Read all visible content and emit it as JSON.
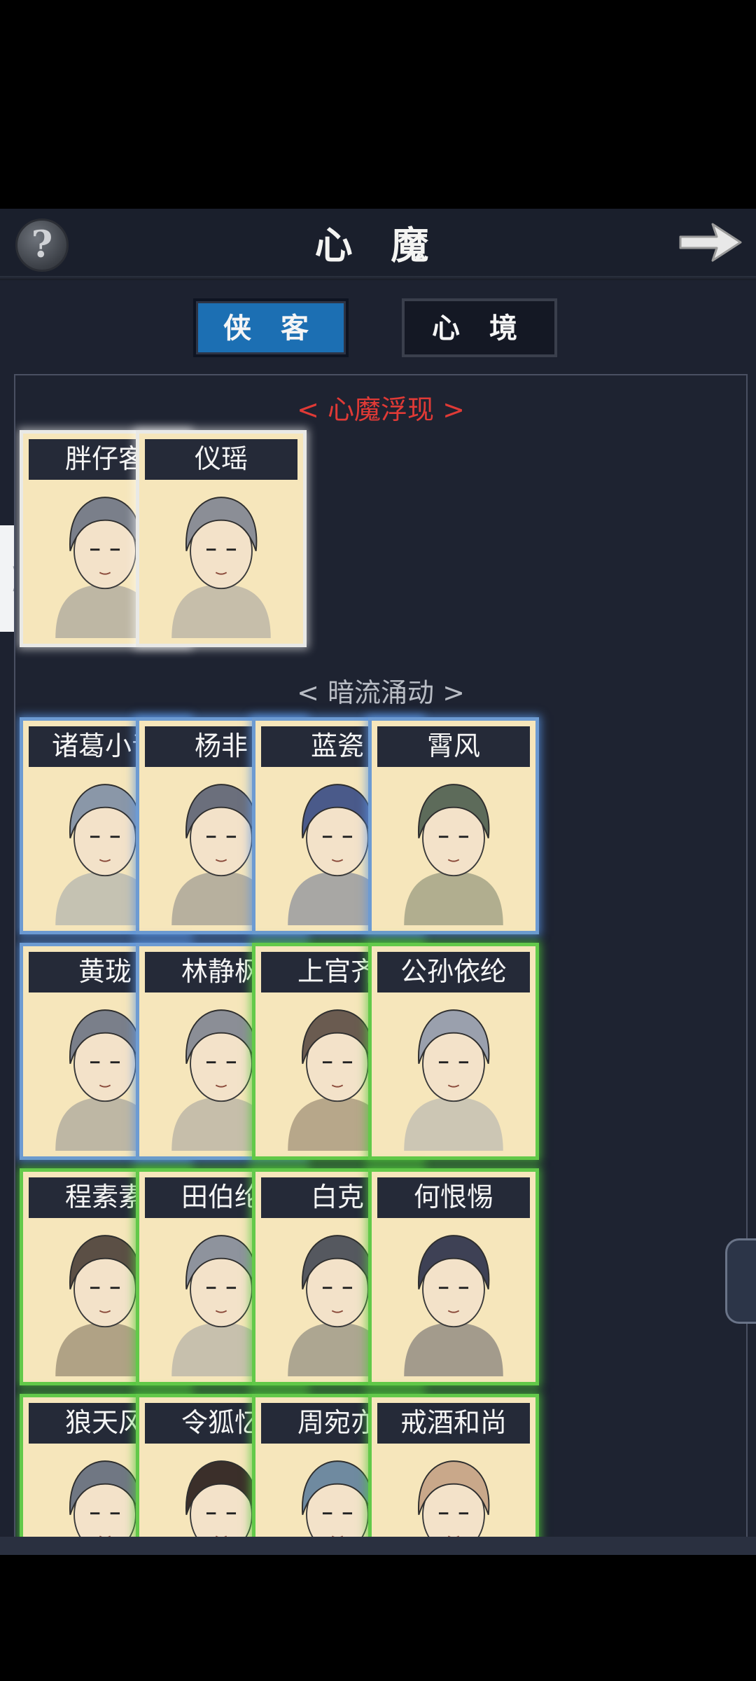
{
  "header": {
    "title": "心 魔",
    "help_glyph": "?",
    "help_icon": "question-mark-icon",
    "next_icon": "arrow-right-icon"
  },
  "side_tab": {
    "glyph": "⟩"
  },
  "tabs": [
    {
      "label": "侠 客",
      "active": true
    },
    {
      "label": "心 境",
      "active": false
    }
  ],
  "sections": {
    "emerging": "< 心魔浮现 >",
    "undercurrent": "< 暗流涌动 >"
  },
  "emerging_cards": [
    {
      "name": "胖仔客",
      "frame": "white"
    },
    {
      "name": "仪瑶",
      "frame": "white"
    }
  ],
  "undercurrent_cards": [
    {
      "name": "诸葛小青",
      "frame": "blue"
    },
    {
      "name": "杨非",
      "frame": "blue"
    },
    {
      "name": "蓝瓷",
      "frame": "blue"
    },
    {
      "name": "霄风",
      "frame": "blue"
    },
    {
      "name": "黄珑",
      "frame": "blue"
    },
    {
      "name": "林静枫",
      "frame": "blue"
    },
    {
      "name": "上官齐",
      "frame": "green"
    },
    {
      "name": "公孙依纶",
      "frame": "green"
    },
    {
      "name": "程素素",
      "frame": "green"
    },
    {
      "name": "田伯纶",
      "frame": "green"
    },
    {
      "name": "白克",
      "frame": "green"
    },
    {
      "name": "何恨惕",
      "frame": "green"
    },
    {
      "name": "狼天风",
      "frame": "green"
    },
    {
      "name": "令狐忆",
      "frame": "green"
    },
    {
      "name": "周宛亦",
      "frame": "green"
    },
    {
      "name": "戒酒和尚",
      "frame": "green"
    }
  ],
  "colors": {
    "background": "#1d2230",
    "active_tab": "#1c6fb3",
    "section_red": "#e03a36",
    "frame_white": "#e9e9e6",
    "frame_blue": "#6d9bd2",
    "frame_green": "#63c94a",
    "card_paper": "#f6e6bb"
  }
}
